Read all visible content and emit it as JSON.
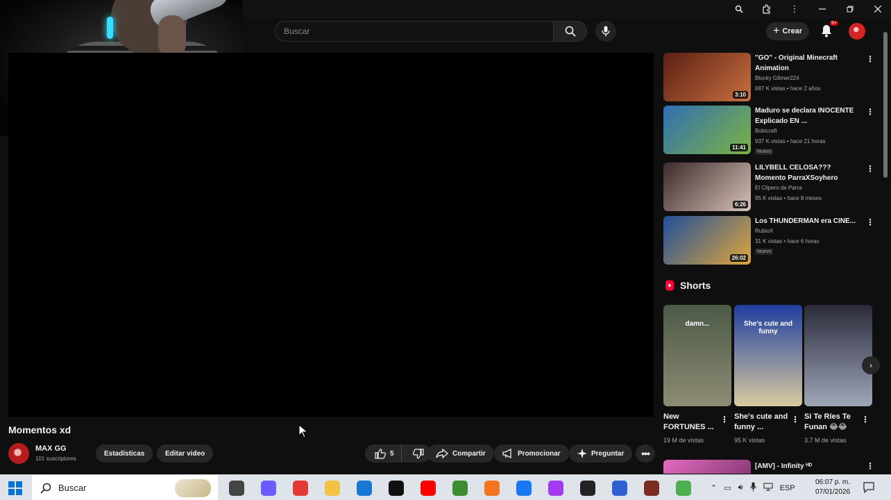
{
  "masthead": {
    "search_placeholder": "Buscar",
    "create_label": "Crear",
    "notifications_badge": "9+"
  },
  "video": {
    "title": "Momentos xd",
    "channel_name": "MAX GG",
    "subscribers": "101 suscriptores",
    "stats_label": "Estadísticas",
    "edit_label": "Editar video",
    "like_count": "5",
    "share_label": "Compartir",
    "promote_label": "Promocionar",
    "ask_label": "Preguntar"
  },
  "recommendations": [
    {
      "title": "\"GO\" - Original Minecraft Animation",
      "channel": "Blocky G8mer224",
      "meta": "687 K vistas • hace 2 años",
      "duration": "3:10",
      "badge": "",
      "colors": [
        "#5b1f14",
        "#c9703f"
      ]
    },
    {
      "title": "Maduro se declara INOCENTE Explicado EN ...",
      "channel": "Bobicraft",
      "meta": "937 K vistas • hace 21 horas",
      "duration": "11:41",
      "badge": "Nuevo",
      "colors": [
        "#2f6fb3",
        "#7cb342"
      ]
    },
    {
      "title": "LILYBELL CELOSA??? Momento ParraXSoyhero",
      "channel": "El Clipero de Parra",
      "meta": "95 K vistas • hace 8 meses",
      "duration": "6:26",
      "badge": "",
      "colors": [
        "#3a2a2a",
        "#d8c2b8"
      ]
    },
    {
      "title": "Los THUNDERMAN era CINE...",
      "channel": "RubioX",
      "meta": "31 K vistas • hace 6 horas",
      "duration": "26:02",
      "badge": "Nuevo",
      "colors": [
        "#1f4f9a",
        "#e0a53b"
      ]
    }
  ],
  "shorts": {
    "heading": "Shorts",
    "items": [
      {
        "title": "New FORTUNES ...",
        "views": "19 M de vistas",
        "overlay": "damn...",
        "colors": [
          "#4c5a46",
          "#8d8b74"
        ]
      },
      {
        "title": "She's cute and funny ...",
        "views": "95 K vistas",
        "overlay": "She's cute and funny",
        "colors": [
          "#1f3ea0",
          "#d9cba0"
        ]
      },
      {
        "title": "Si Te Ríes Te Funan 😂😂",
        "views": "3.7 M de vistas",
        "overlay": "",
        "colors": [
          "#2a2a3a",
          "#9ea7b8"
        ]
      }
    ]
  },
  "next_item": {
    "title": "[AMV] - Infinity ᴴᴰ"
  },
  "taskbar": {
    "search_label": "Buscar",
    "language": "ESP",
    "time": "06:07 p. m.",
    "date": "07/01/2026",
    "apps": [
      {
        "name": "task-view",
        "color": "#444"
      },
      {
        "name": "copilot",
        "color": "#6a5cff"
      },
      {
        "name": "chrome",
        "color": "#e53935"
      },
      {
        "name": "file-explorer",
        "color": "#f3c245"
      },
      {
        "name": "outlook",
        "color": "#1976d2"
      },
      {
        "name": "tiktok",
        "color": "#111111"
      },
      {
        "name": "youtube",
        "color": "#ff0000"
      },
      {
        "name": "minecraft",
        "color": "#3c8d2f"
      },
      {
        "name": "crunchyroll",
        "color": "#f47521"
      },
      {
        "name": "facebook",
        "color": "#1877f2"
      },
      {
        "name": "messenger",
        "color": "#a33cf0"
      },
      {
        "name": "obs",
        "color": "#222222"
      },
      {
        "name": "tasks",
        "color": "#2f5fd0"
      },
      {
        "name": "minecraft-dungeons",
        "color": "#7b2d1f"
      },
      {
        "name": "minecraft-launcher",
        "color": "#4caf50"
      }
    ]
  }
}
